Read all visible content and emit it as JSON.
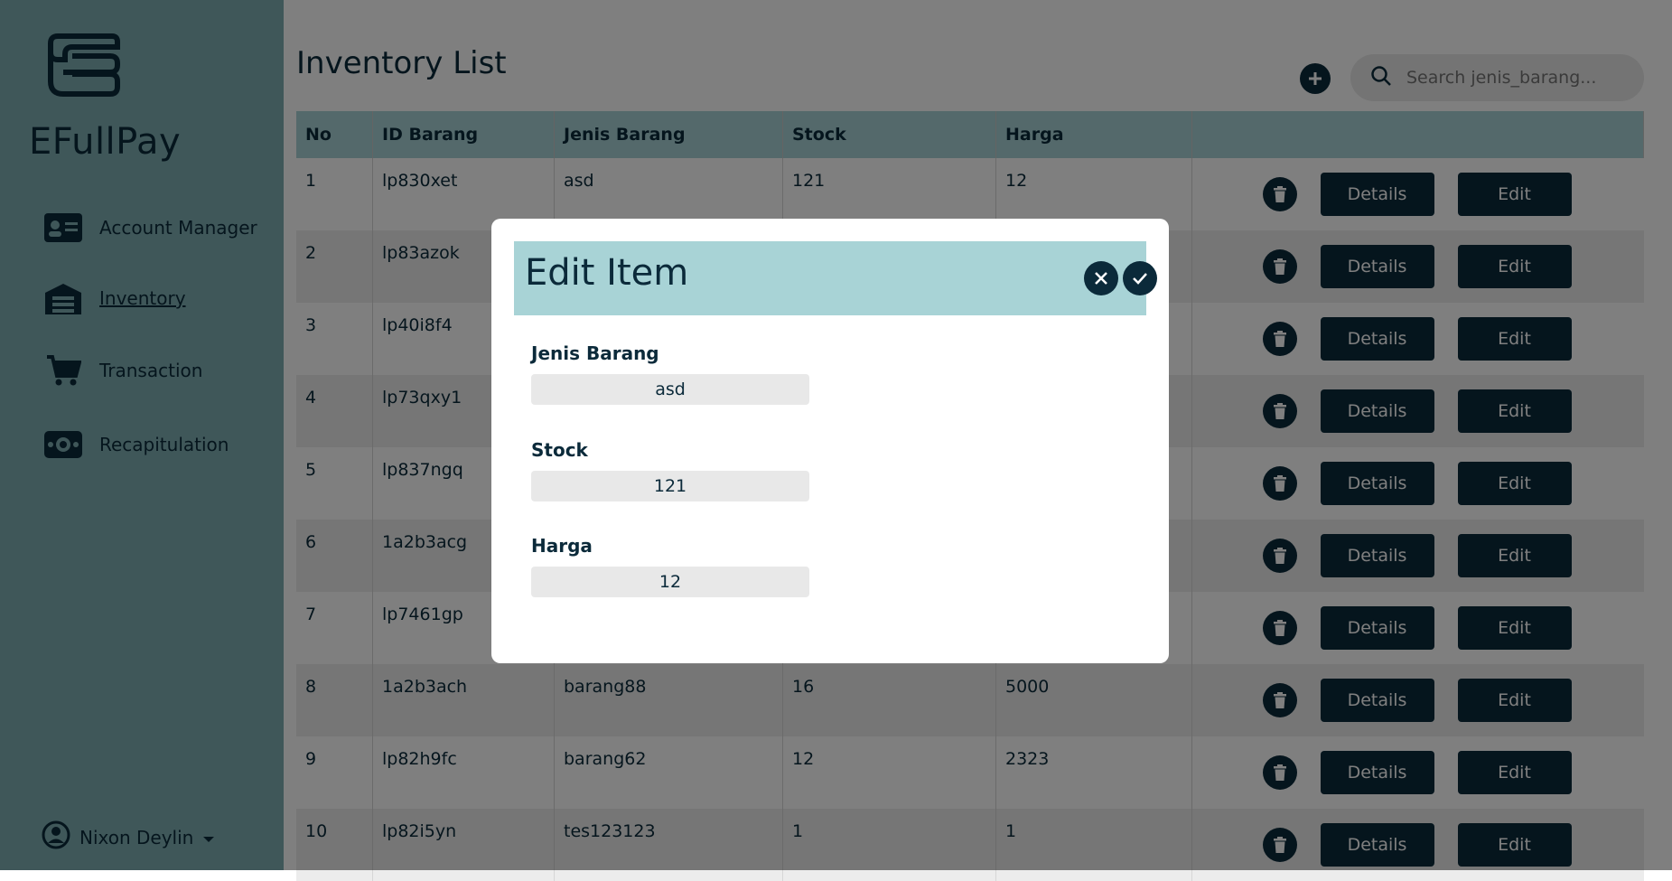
{
  "sidebar": {
    "brand": "EFullPay",
    "items": [
      {
        "label": "Account Manager",
        "icon": "id-card-icon"
      },
      {
        "label": "Inventory",
        "icon": "warehouse-icon"
      },
      {
        "label": "Transaction",
        "icon": "cart-icon"
      },
      {
        "label": "Recapitulation",
        "icon": "money-icon"
      }
    ],
    "user": "Nixon Deylin"
  },
  "main": {
    "title": "Inventory List",
    "search_placeholder": "Search jenis_barang...",
    "columns": [
      "No",
      "ID Barang",
      "Jenis Barang",
      "Stock",
      "Harga"
    ],
    "rows": [
      [
        "1",
        "lp830xet",
        "asd",
        "121",
        "12"
      ],
      [
        "2",
        "lp83azok",
        "",
        "",
        ""
      ],
      [
        "3",
        "lp40i8f4",
        "",
        "",
        ""
      ],
      [
        "4",
        "lp73qxy1",
        "",
        "",
        ""
      ],
      [
        "5",
        "lp837ngq",
        "",
        "",
        ""
      ],
      [
        "6",
        "1a2b3acg",
        "",
        "",
        ""
      ],
      [
        "7",
        "lp7461gp",
        "",
        "",
        ""
      ],
      [
        "8",
        "1a2b3ach",
        "barang88",
        "16",
        "5000"
      ],
      [
        "9",
        "lp82h9fc",
        "barang62",
        "12",
        "2323"
      ],
      [
        "10",
        "lp82i5yn",
        "tes123123",
        "1",
        "1"
      ]
    ],
    "details_label": "Details",
    "edit_label": "Edit"
  },
  "modal": {
    "title": "Edit Item",
    "fields": [
      {
        "label": "Jenis Barang",
        "value": "asd"
      },
      {
        "label": "Stock",
        "value": "121"
      },
      {
        "label": "Harga",
        "value": "12"
      }
    ]
  },
  "colors": {
    "sidebar_bg": "#7fafb3",
    "header_bg": "#a8d3d6",
    "dark": "#0b2a3a"
  }
}
